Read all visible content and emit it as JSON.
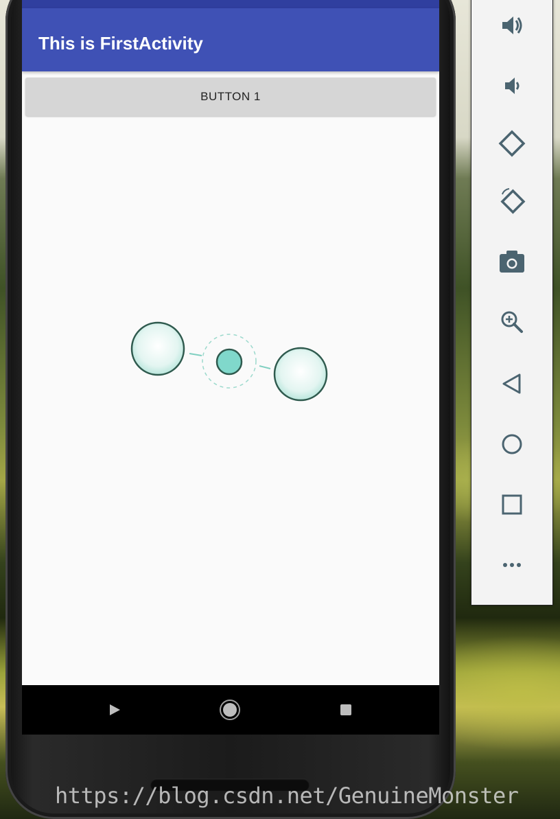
{
  "app": {
    "title": "This is FirstActivity",
    "button_1_label": "BUTTON 1"
  },
  "colors": {
    "app_bar": "#3f51b5",
    "status_bar": "#303f9f",
    "accent_teal": "#80d8cb",
    "circle_stroke": "#2f5a4e"
  },
  "emulator_toolbar": {
    "buttons": [
      {
        "icon": "volume-up-icon"
      },
      {
        "icon": "volume-down-icon"
      },
      {
        "icon": "rotate-left-icon"
      },
      {
        "icon": "rotate-right-icon"
      },
      {
        "icon": "camera-icon"
      },
      {
        "icon": "zoom-in-icon"
      },
      {
        "icon": "back-icon"
      },
      {
        "icon": "home-icon"
      },
      {
        "icon": "overview-icon"
      },
      {
        "icon": "more-icon"
      }
    ]
  },
  "watermark": "https://blog.csdn.net/GenuineMonster"
}
